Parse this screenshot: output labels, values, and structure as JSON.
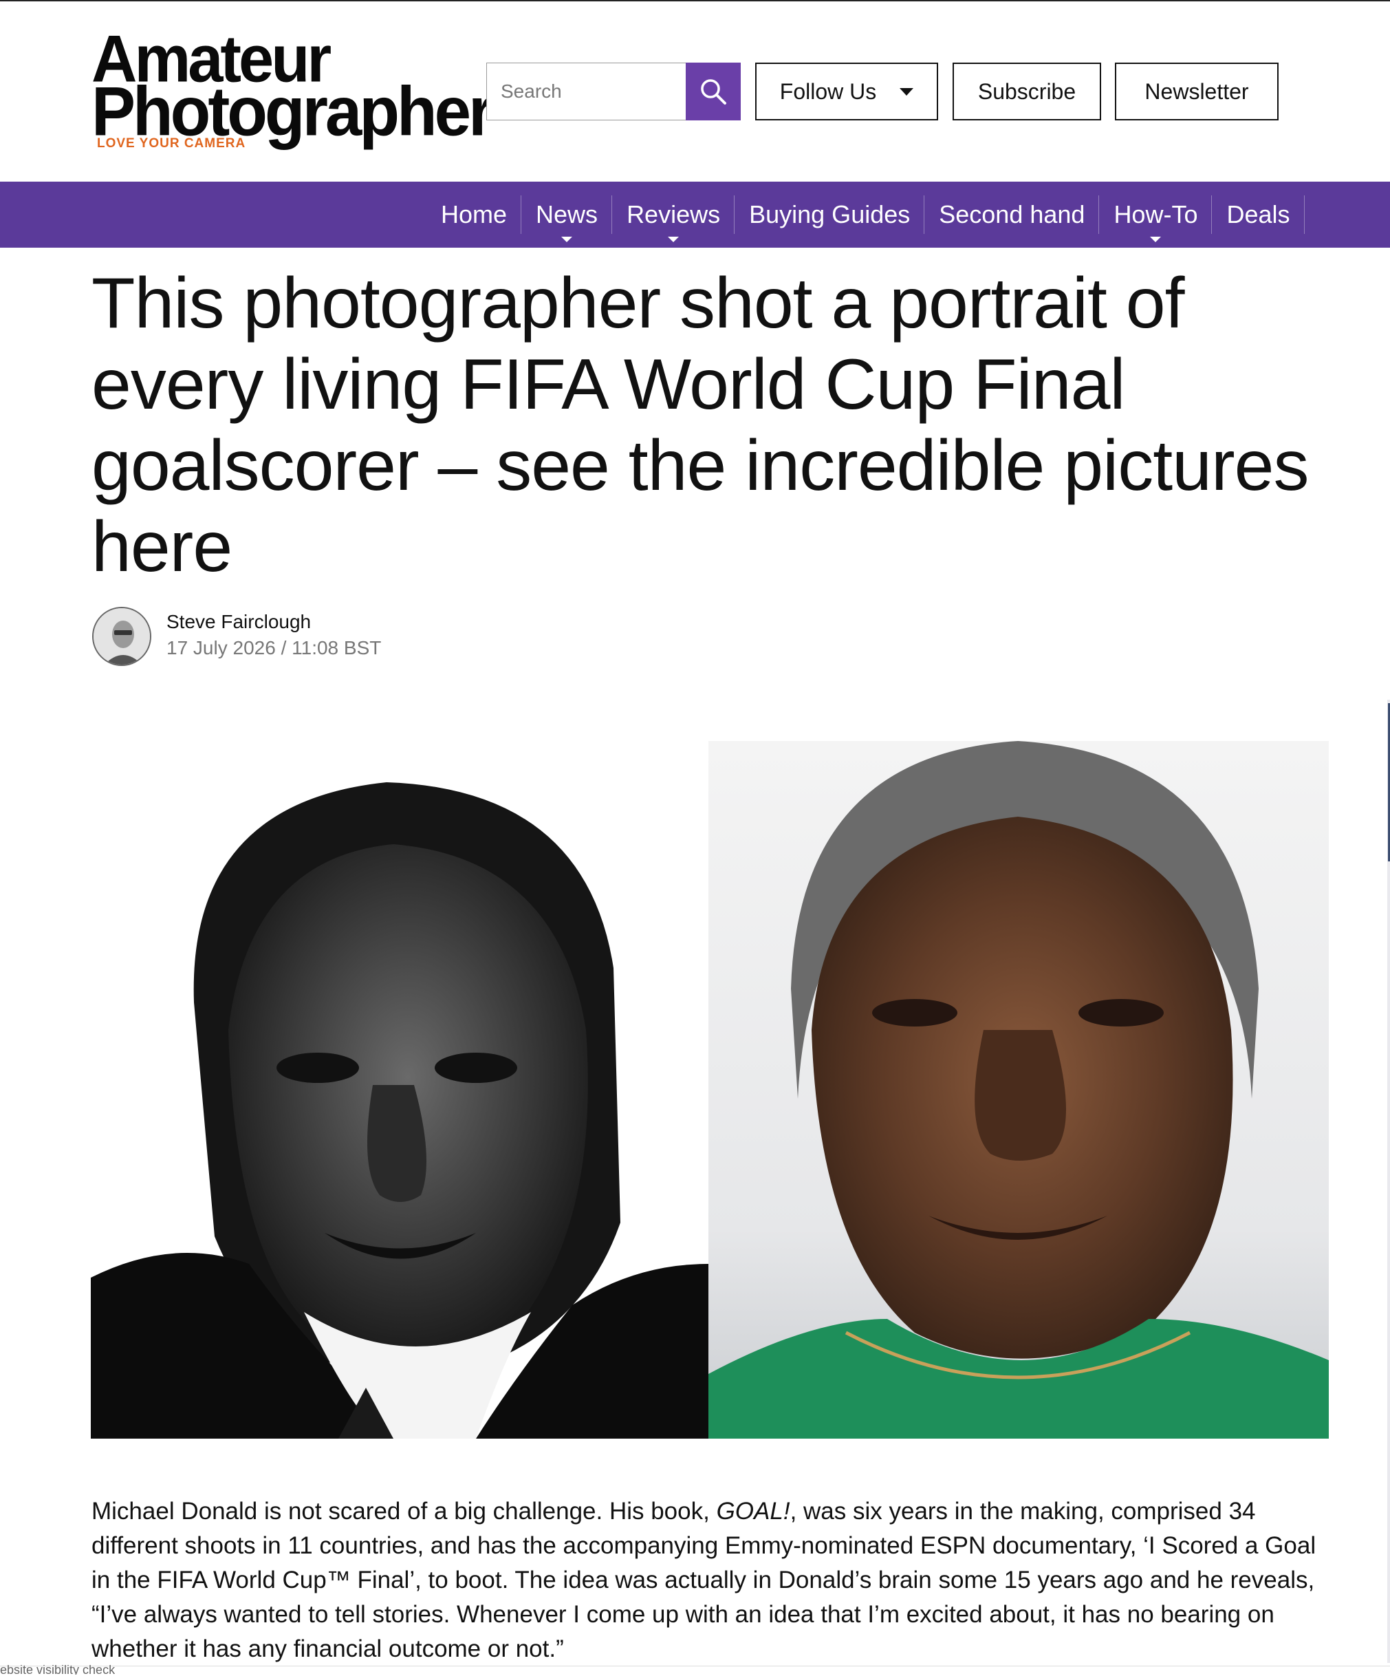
{
  "header": {
    "logo": {
      "line1": "Amateur",
      "line2": "Photographer",
      "tagline": "LOVE YOUR CAMERA"
    },
    "search": {
      "placeholder": "Search"
    },
    "buttons": {
      "follow": "Follow Us",
      "subscribe": "Subscribe",
      "newsletter": "Newsletter"
    }
  },
  "nav": {
    "items": [
      {
        "label": "Home"
      },
      {
        "label": "News"
      },
      {
        "label": "Reviews"
      },
      {
        "label": "Buying Guides"
      },
      {
        "label": "Second hand"
      },
      {
        "label": "How-To"
      },
      {
        "label": "Deals"
      }
    ]
  },
  "article": {
    "title": "This photographer shot a portrait of every living FIFA World Cup Final goalscorer – see the incredible pictures here",
    "author": "Steve Fairclough",
    "date": "17 July 2026 / 11:08 BST",
    "body": {
      "part1": "Michael Donald is not scared of a big challenge. His book, ",
      "book": "GOAL!",
      "part2": ", was six years in the making, comprised 34 different shoots in 11 countries, and has the accompanying Emmy-nominated ESPN documentary, ‘I Scored a Goal in the FIFA World Cup™ Final’, to boot. The idea was actually in Donald’s brain some 15 years ago and he reveals, “I’ve always wanted to tell stories. Whenever I come up with an idea that I’m excited about, it has no bearing on whether it has any financial outcome or not.”"
    }
  },
  "footer": {
    "label": "ebsite visibility check"
  },
  "colors": {
    "brand_purple": "#5b3a9a",
    "search_button": "#6a3fa8",
    "tagline_orange": "#e0661f"
  }
}
